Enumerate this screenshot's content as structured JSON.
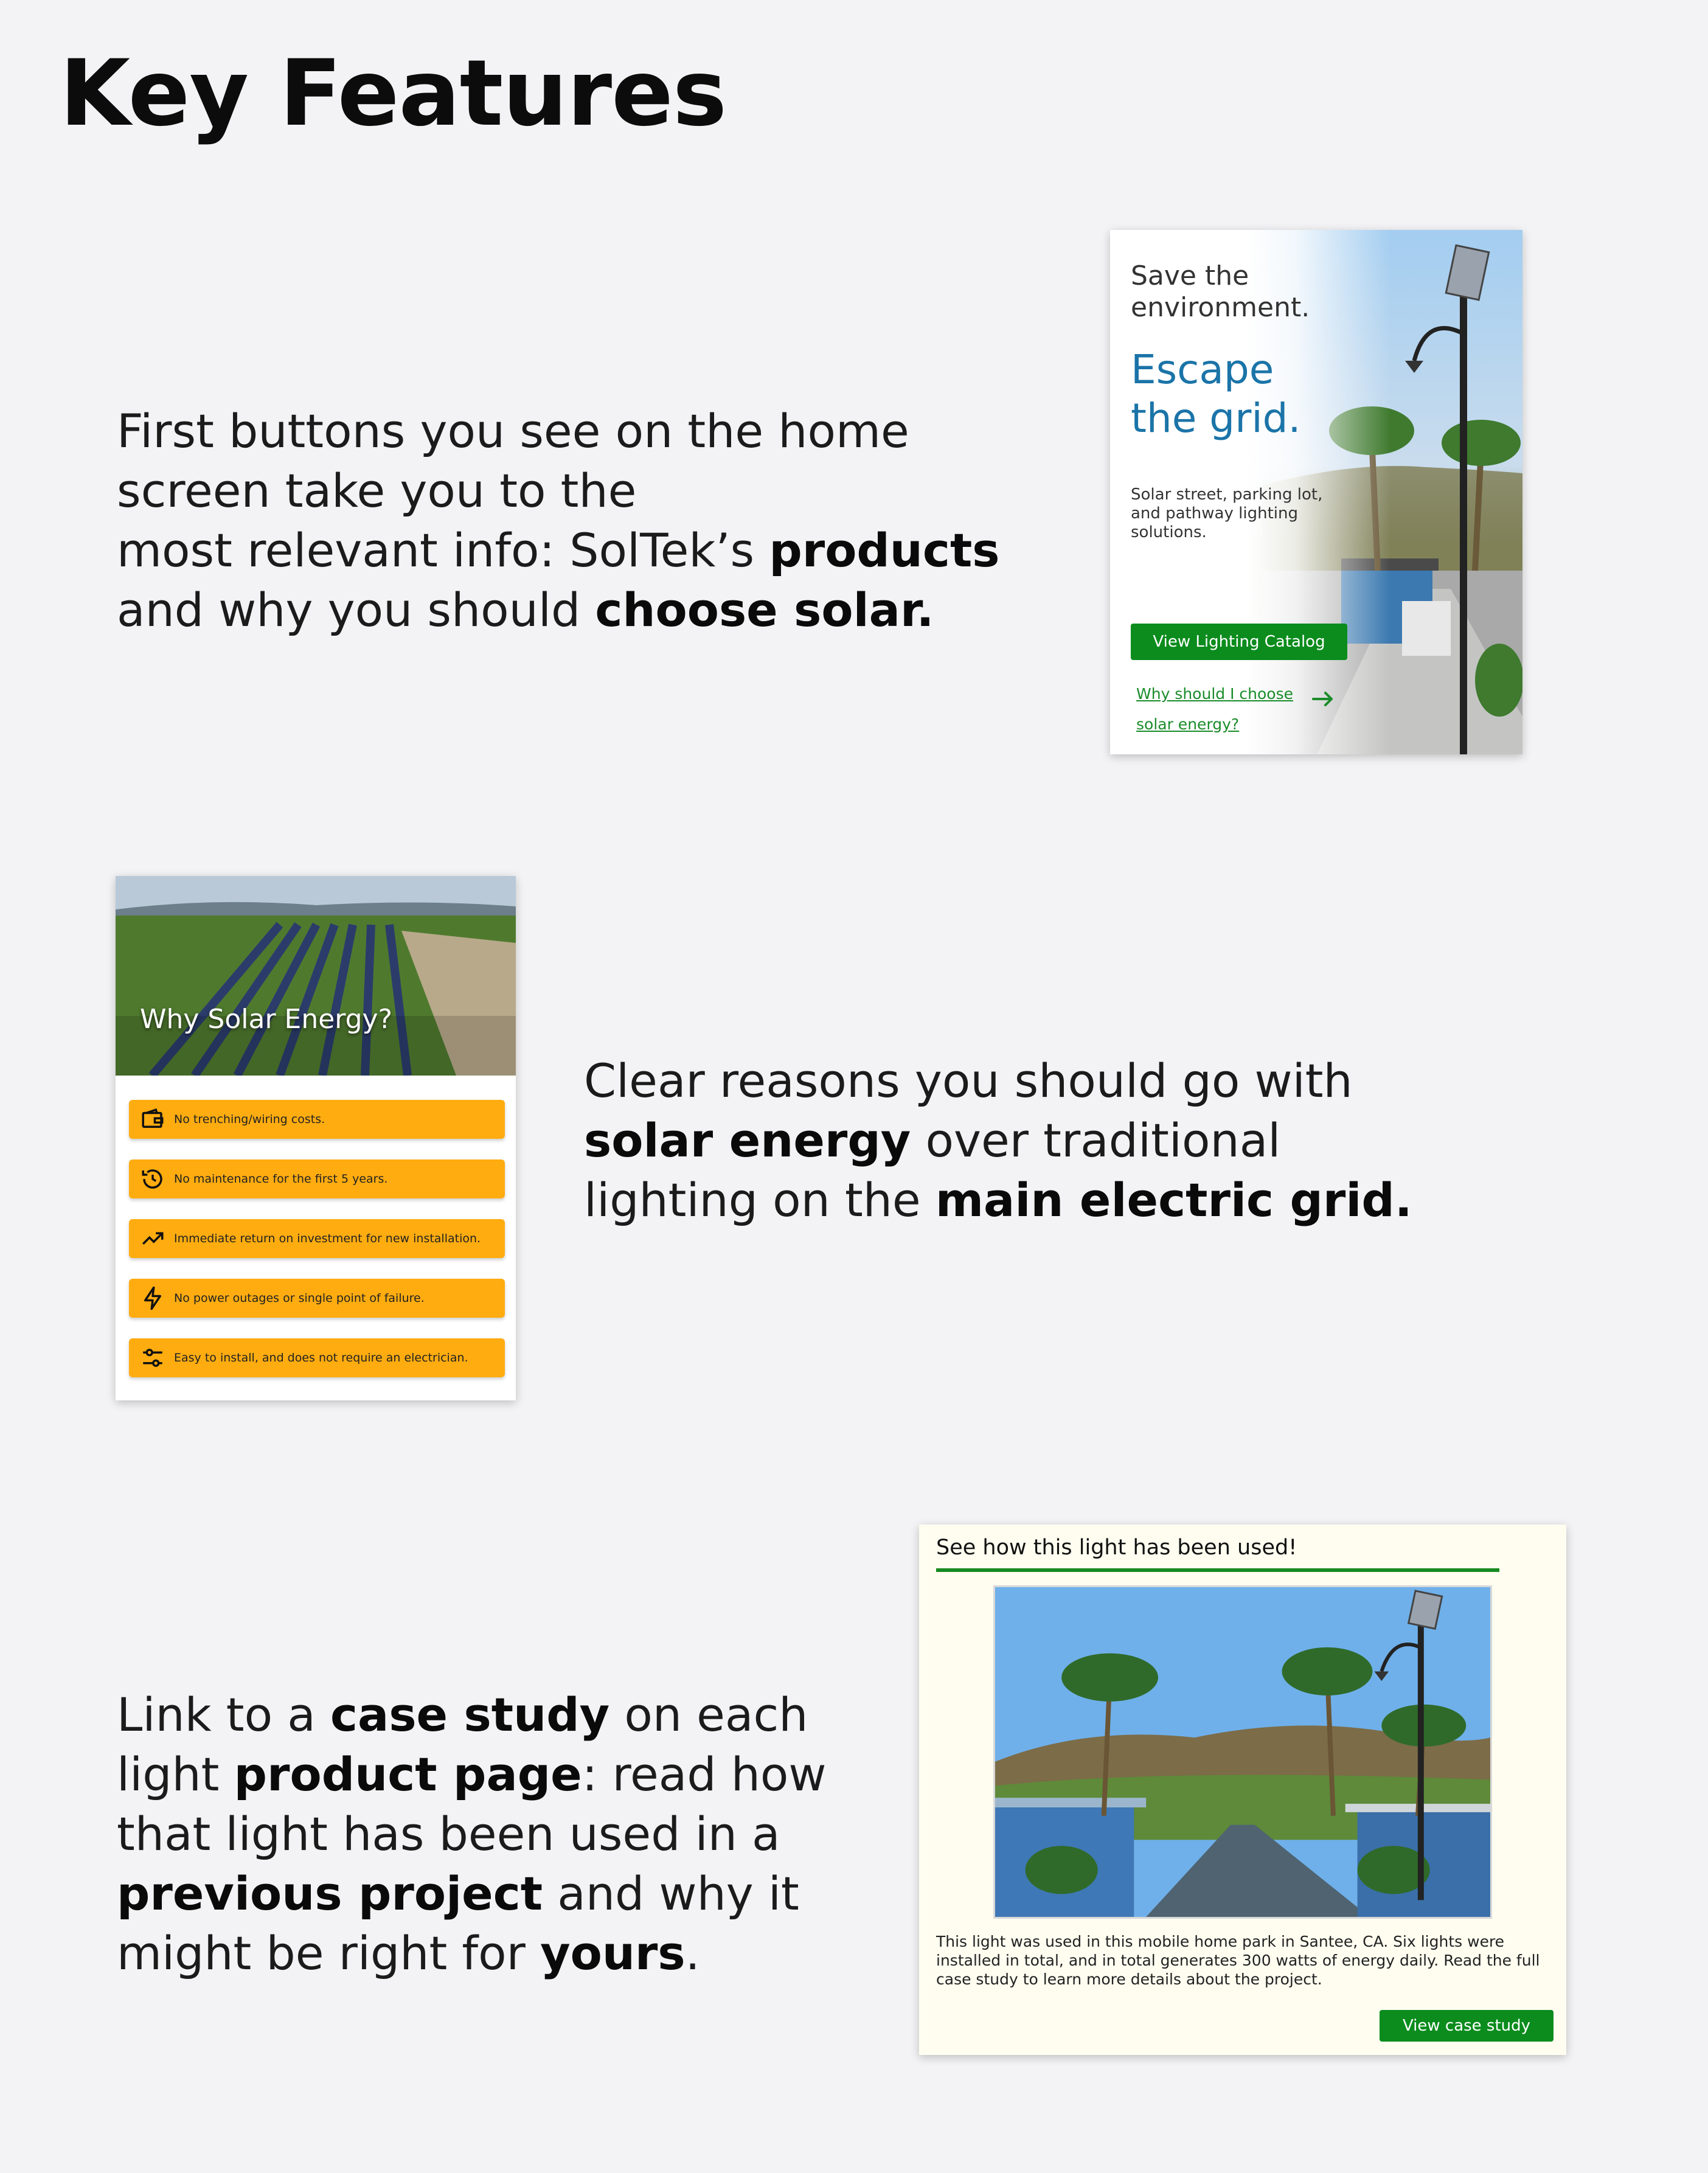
{
  "page": {
    "title": "Key Features"
  },
  "sections": {
    "intro": {
      "line1": "First buttons you see on the home",
      "line2": "screen take you to the",
      "line3_a": "most relevant info: SolTek’s ",
      "line3_b": "products",
      "line4_a": "and why you should ",
      "line4_b": "choose solar."
    },
    "reasons_desc": {
      "line1": "Clear reasons you should go with",
      "line2_a": "solar energy",
      "line2_b": " over traditional",
      "line3_a": "lighting on the ",
      "line3_b": "main electric grid."
    },
    "case_desc": {
      "line1_a": "Link to a ",
      "line1_b": "case study",
      "line1_c": " on each",
      "line2_a": "light ",
      "line2_b": "product page",
      "line2_c": ": read how",
      "line3": "that light has been used in a",
      "line4_a": "previous project",
      "line4_b": " and why it",
      "line5_a": "might be right for ",
      "line5_b": "yours",
      "line5_c": "."
    }
  },
  "hero_card": {
    "tagline_1": "Save the",
    "tagline_2": "environment.",
    "headline_1": "Escape",
    "headline_2": "the grid.",
    "subtitle": "Solar street, parking lot, and pathway lighting solutions.",
    "primary_button": "View Lighting Catalog",
    "link_1": "Why should I choose",
    "link_2": "solar energy?",
    "accent": "#0b8c1d",
    "headline_color": "#1b74a8"
  },
  "why_card": {
    "title": "Why Solar Energy?",
    "reasons": [
      {
        "icon": "wallet-icon",
        "text": "No trenching/wiring costs."
      },
      {
        "icon": "history-clock-icon",
        "text": "No maintenance for the first 5 years."
      },
      {
        "icon": "trending-up-icon",
        "text": "Immediate return on investment for new installation."
      },
      {
        "icon": "lightning-bolt-icon",
        "text": "No power outages or single point of failure."
      },
      {
        "icon": "sliders-icon",
        "text": "Easy to install, and does not require an electrician."
      }
    ],
    "reason_color": "#ffac10"
  },
  "case_card": {
    "title": "See how this light has been used!",
    "description": "This light was used in this mobile home park in Santee, CA. Six lights were installed in total, and in total generates 300 watts of energy daily. Read the full case study to learn more details about the project.",
    "button": "View case study"
  }
}
